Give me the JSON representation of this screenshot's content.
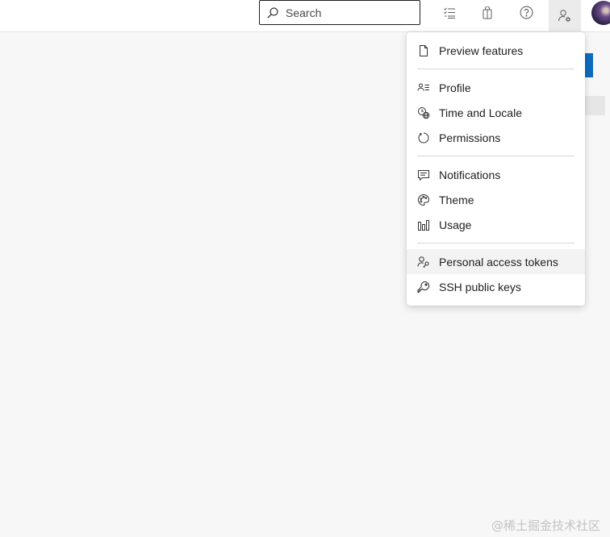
{
  "search": {
    "placeholder": "Search"
  },
  "toolbar": {
    "icons": [
      "task-list-icon",
      "shopping-bag-icon",
      "help-icon",
      "user-settings-icon"
    ]
  },
  "menu": {
    "items": [
      {
        "label": "Preview features",
        "icon": "document-icon"
      },
      {
        "label": "Profile",
        "icon": "profile-icon"
      },
      {
        "label": "Time and Locale",
        "icon": "globe-clock-icon"
      },
      {
        "label": "Permissions",
        "icon": "refresh-circle-icon"
      },
      {
        "label": "Notifications",
        "icon": "comment-icon"
      },
      {
        "label": "Theme",
        "icon": "palette-icon"
      },
      {
        "label": "Usage",
        "icon": "bar-chart-icon"
      },
      {
        "label": "Personal access tokens",
        "icon": "user-key-icon"
      },
      {
        "label": "SSH public keys",
        "icon": "key-icon"
      }
    ],
    "highlighted": "Personal access tokens"
  },
  "watermark": "@稀土掘金技术社区",
  "colors": {
    "accent": "#0f6cbd",
    "page_background": "#f7f7f7",
    "menu_hover": "#f3f3f3"
  }
}
